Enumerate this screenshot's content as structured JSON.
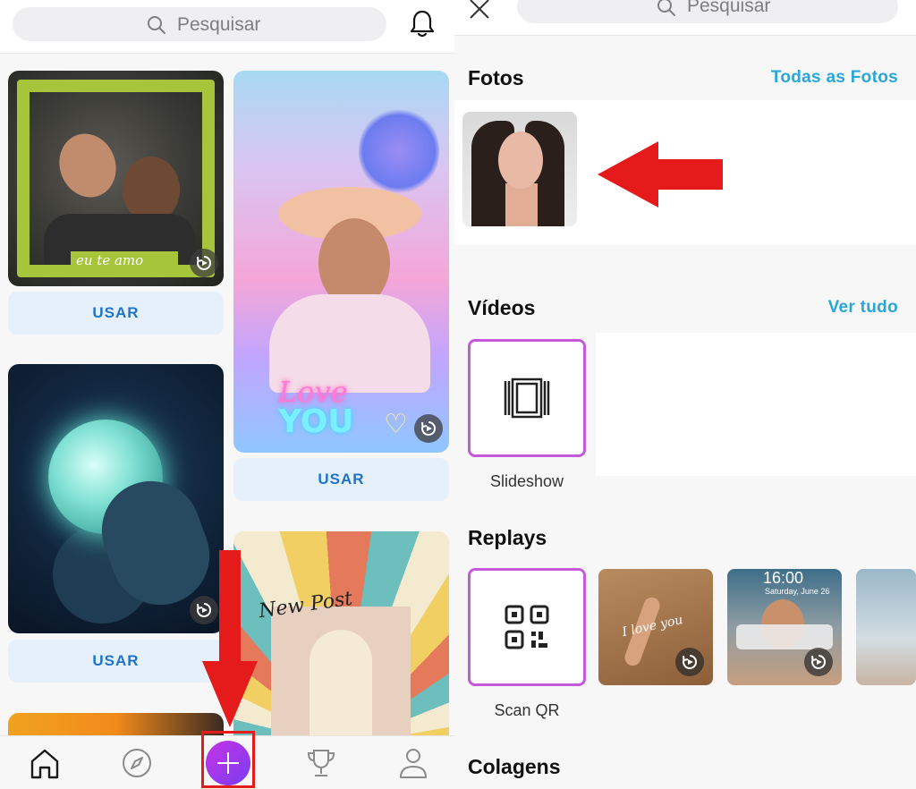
{
  "left": {
    "search": {
      "placeholder": "Pesquisar"
    },
    "cards": [
      {
        "overlay_text": "eu te amo",
        "button": "USAR"
      },
      {
        "overlay_text": "Love",
        "overlay_text_2": "YOU",
        "button": "USAR"
      },
      {
        "button": "USAR"
      },
      {
        "overlay_text": "New Post"
      }
    ],
    "tabbar": {
      "items": [
        "home-icon",
        "explore-compass-icon",
        "create-plus-icon",
        "challenges-trophy-icon",
        "profile-icon"
      ]
    }
  },
  "right": {
    "search": {
      "placeholder": "Pesquisar"
    },
    "fotos": {
      "title": "Fotos",
      "link": "Todas as Fotos"
    },
    "videos": {
      "title": "Vídeos",
      "link": "Ver tudo",
      "tile_label": "Slideshow"
    },
    "replays": {
      "title": "Replays",
      "tile_label": "Scan QR",
      "thumbs": [
        {
          "text": "I love you"
        },
        {
          "time": "16:00",
          "date": "Saturday, June 26"
        },
        {}
      ]
    },
    "colagens": {
      "title": "Colagens"
    }
  },
  "colors": {
    "accent_blue": "#2aa6d8",
    "button_text": "#1e74c7",
    "button_bg": "#e6f0fb",
    "tile_border": "#c45ad9",
    "create_gradient_start": "#c632e6",
    "create_gradient_end": "#7a3df0",
    "annotation_red": "#e51a1a"
  }
}
